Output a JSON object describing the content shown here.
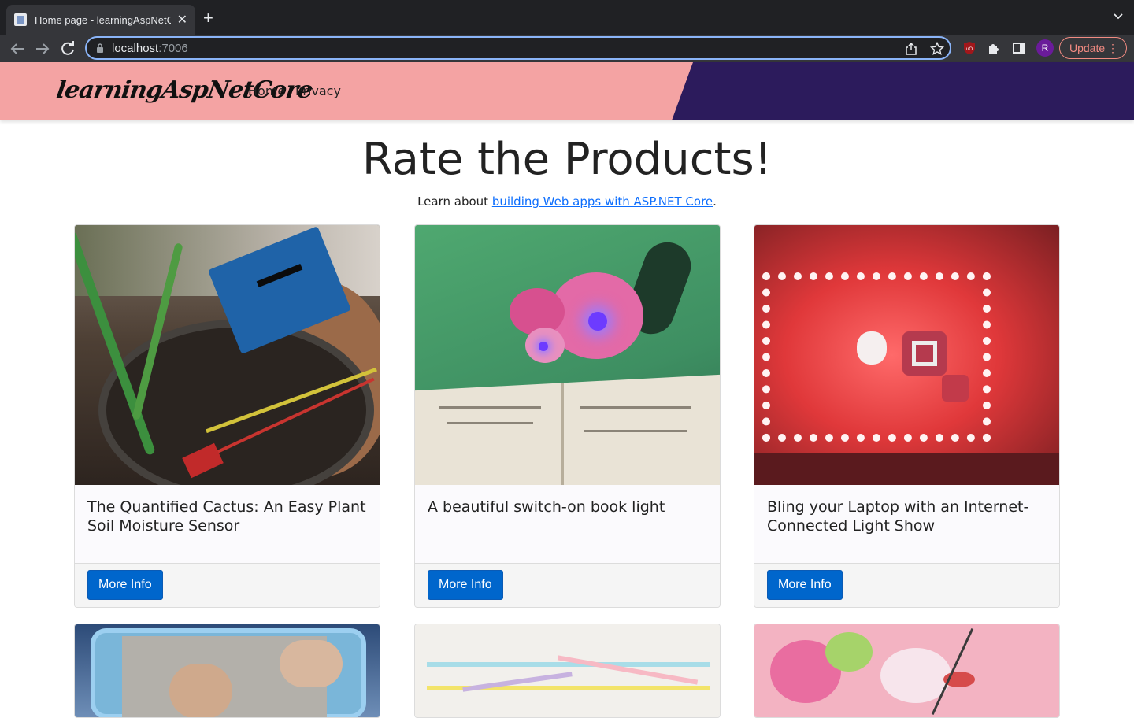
{
  "browser": {
    "tab_title": "Home page - learningAspNetC",
    "tab_close": "✕",
    "new_tab": "+",
    "url_host": "localhost",
    "url_port": ":7006",
    "profile_initial": "R",
    "update_label": "Update",
    "update_menu": "⋮"
  },
  "site": {
    "brand": "learningAspNetCore",
    "nav": [
      {
        "label": "Home"
      },
      {
        "label": "Privacy"
      }
    ]
  },
  "main": {
    "title": "Rate the Products!",
    "subtitle_prefix": "Learn about ",
    "subtitle_link": "building Web apps with ASP.NET Core",
    "subtitle_suffix": "."
  },
  "products": [
    {
      "title": "The Quantified Cactus: An Easy Plant Soil Moisture Sensor",
      "button": "More Info"
    },
    {
      "title": "A beautiful switch-on book light",
      "button": "More Info"
    },
    {
      "title": "Bling your Laptop with an Internet-Connected Light Show",
      "button": "More Info"
    }
  ],
  "colors": {
    "header_pink": "#f4a3a3",
    "header_purple": "#2c1b5c",
    "button_blue": "#0066cc",
    "link_blue": "#0d6efd"
  }
}
